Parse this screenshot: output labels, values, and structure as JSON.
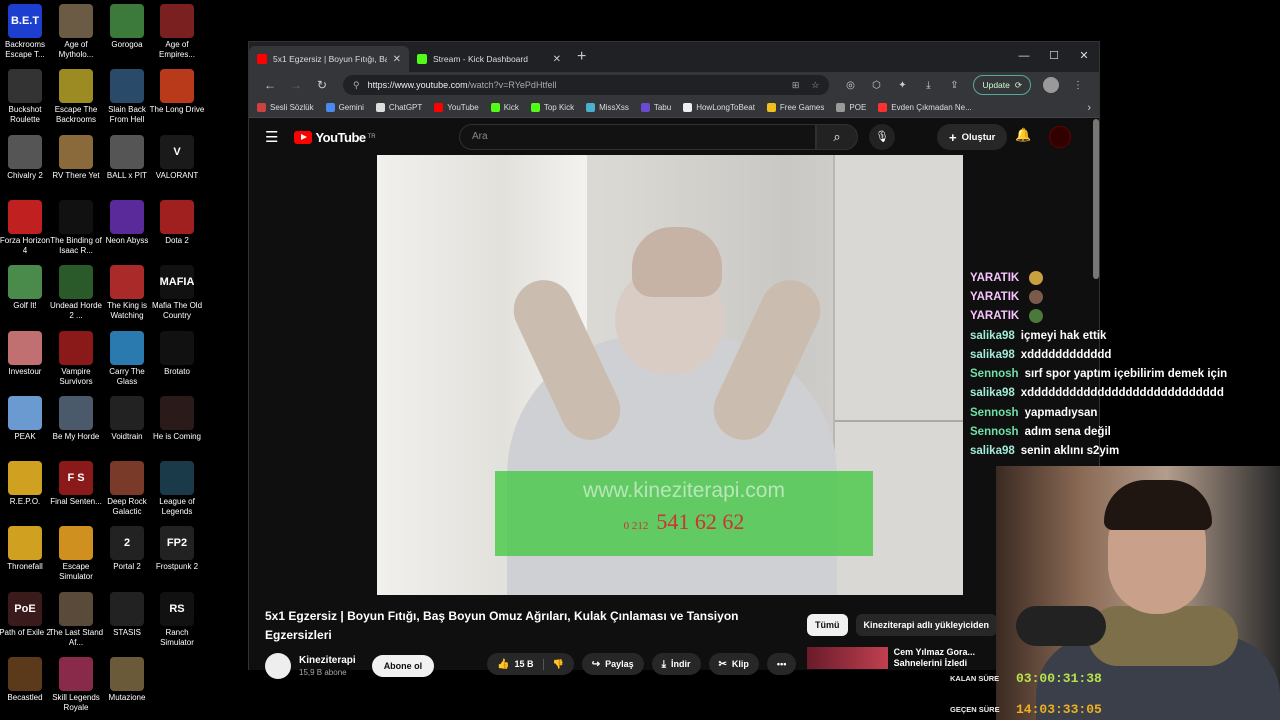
{
  "desktop_icons": [
    {
      "label": "Backrooms Escape T...",
      "bg": "#1d3fd0",
      "glyph": "B.E.T"
    },
    {
      "label": "Age of Mytholo...",
      "bg": "#6b5a44",
      "glyph": ""
    },
    {
      "label": "Gorogoa",
      "bg": "#3c7a3c",
      "glyph": ""
    },
    {
      "label": "Age of Empires...",
      "bg": "#7a2020",
      "glyph": ""
    },
    {
      "label": "Buckshot Roulette",
      "bg": "#333",
      "glyph": ""
    },
    {
      "label": "Escape The Backrooms",
      "bg": "#9b8b22",
      "glyph": ""
    },
    {
      "label": "Slain Back From Hell",
      "bg": "#2a4a6a",
      "glyph": ""
    },
    {
      "label": "The Long Drive",
      "bg": "#b83a1a",
      "glyph": ""
    },
    {
      "label": "Chivalry 2",
      "bg": "#555",
      "glyph": ""
    },
    {
      "label": "RV There Yet",
      "bg": "#8a6a3a",
      "glyph": ""
    },
    {
      "label": "BALL x PIT",
      "bg": "#555",
      "glyph": ""
    },
    {
      "label": "VALORANT",
      "bg": "#1a1a1a",
      "glyph": "V"
    },
    {
      "label": "Forza Horizon 4",
      "bg": "#c02020",
      "glyph": ""
    },
    {
      "label": "The Binding of Isaac R...",
      "bg": "#111",
      "glyph": ""
    },
    {
      "label": "Neon Abyss",
      "bg": "#5a2a9a",
      "glyph": ""
    },
    {
      "label": "Dota 2",
      "bg": "#a02020",
      "glyph": ""
    },
    {
      "label": "Golf It!",
      "bg": "#4a8a4a",
      "glyph": ""
    },
    {
      "label": "Undead Horde 2 ...",
      "bg": "#2a5a2a",
      "glyph": ""
    },
    {
      "label": "The King is Watching",
      "bg": "#aa2a2a",
      "glyph": ""
    },
    {
      "label": "Mafia The Old Country",
      "bg": "#111",
      "glyph": "MAFIA"
    },
    {
      "label": "Investour",
      "bg": "#c07070",
      "glyph": ""
    },
    {
      "label": "Vampire Survivors",
      "bg": "#8a1a1a",
      "glyph": ""
    },
    {
      "label": "Carry The Glass",
      "bg": "#2a7ab0",
      "glyph": ""
    },
    {
      "label": "Brotato",
      "bg": "#111",
      "glyph": ""
    },
    {
      "label": "PEAK",
      "bg": "#6a9ad0",
      "glyph": ""
    },
    {
      "label": "Be My Horde",
      "bg": "#4a5a6a",
      "glyph": ""
    },
    {
      "label": "Voidtrain",
      "bg": "#222",
      "glyph": ""
    },
    {
      "label": "He is Coming",
      "bg": "#2a1a1a",
      "glyph": ""
    },
    {
      "label": "R.E.P.O.",
      "bg": "#d0a020",
      "glyph": ""
    },
    {
      "label": "Final Senten...",
      "bg": "#8a1a1a",
      "glyph": "F S"
    },
    {
      "label": "Deep Rock Galactic",
      "bg": "#7a3a2a",
      "glyph": ""
    },
    {
      "label": "League of Legends",
      "bg": "#1a3a4a",
      "glyph": ""
    },
    {
      "label": "Thronefall",
      "bg": "#d0a020",
      "glyph": ""
    },
    {
      "label": "Escape Simulator",
      "bg": "#d09020",
      "glyph": ""
    },
    {
      "label": "Portal 2",
      "bg": "#222",
      "glyph": "2"
    },
    {
      "label": "Frostpunk 2",
      "bg": "#222",
      "glyph": "FP2"
    },
    {
      "label": "Path of Exile 2",
      "bg": "#3a1a1a",
      "glyph": "PoE"
    },
    {
      "label": "The Last Stand Af...",
      "bg": "#5a4a3a",
      "glyph": ""
    },
    {
      "label": "STASIS",
      "bg": "#222",
      "glyph": ""
    },
    {
      "label": "Ranch Simulator",
      "bg": "#111",
      "glyph": "RS"
    },
    {
      "label": "Becastled",
      "bg": "#5a3a1a",
      "glyph": ""
    },
    {
      "label": "Skill Legends Royale",
      "bg": "#8a2a4a",
      "glyph": ""
    },
    {
      "label": "Mutazione",
      "bg": "#6a5a3a",
      "glyph": ""
    }
  ],
  "browser": {
    "tabs": [
      {
        "title": "5x1 Egzersiz | Boyun Fıtığı, Baş Bo...",
        "favicon_color": "#ff0000",
        "active": true
      },
      {
        "title": "Stream - Kick Dashboard",
        "favicon_color": "#53fc18",
        "active": false
      }
    ],
    "new_tab": "+",
    "window_controls": [
      "—",
      "☐",
      "✕"
    ],
    "url_host": "https://www.youtube.com",
    "url_path": "/watch?v=RYePdHtfell",
    "update_label": "Update",
    "bookmarks": [
      {
        "label": "Sesli Sözlük",
        "color": "#d04040"
      },
      {
        "label": "Gemini",
        "color": "#4a8af0"
      },
      {
        "label": "ChatGPT",
        "color": "#ddd"
      },
      {
        "label": "YouTube",
        "color": "#ff0000"
      },
      {
        "label": "Kick",
        "color": "#53fc18"
      },
      {
        "label": "Top Kick",
        "color": "#53fc18"
      },
      {
        "label": "MissXss",
        "color": "#4ab0d0"
      },
      {
        "label": "Tabu",
        "color": "#6a4ad0"
      },
      {
        "label": "HowLongToBeat",
        "color": "#eee"
      },
      {
        "label": "Free Games",
        "color": "#f0c020"
      },
      {
        "label": "POE",
        "color": "#999"
      },
      {
        "label": "Evden Çıkmadan Ne...",
        "color": "#ff3030"
      }
    ]
  },
  "youtube": {
    "logo_text": "YouTube",
    "region": "TR",
    "search_placeholder": "Ara",
    "create_label": "Oluştur",
    "watermark_url": "www.kineziterapi.com",
    "watermark_prefix": "0 212",
    "watermark_phone": "541 62 62",
    "video_title": "5x1 Egzersiz | Boyun Fıtığı, Baş Boyun Omuz Ağrıları, Kulak Çınlaması ve Tansiyon Egzersizleri",
    "channel_name": "Kineziterapi",
    "channel_subs": "15,9 B abone",
    "subscribe_label": "Abone ol",
    "like_count": "15 B",
    "share_label": "Paylaş",
    "download_label": "İndir",
    "clip_label": "Klip",
    "more": "•••",
    "chips": [
      "Tümü",
      "Kineziterapi adlı yükleyiciden"
    ],
    "reco_title": "Cem Yılmaz Gora... Sahnelerini İzledi"
  },
  "chat": [
    {
      "user": "YARATIK",
      "msg": "",
      "user_color": "#f7c4ff",
      "emoji_color": "#c8a040"
    },
    {
      "user": "YARATIK",
      "msg": "",
      "user_color": "#f7c4ff",
      "emoji_color": "#7a5a4a"
    },
    {
      "user": "YARATIK",
      "msg": "",
      "user_color": "#f7c4ff",
      "emoji_color": "#4a7a3a"
    },
    {
      "user": "salika98",
      "msg": "içmeyi hak ettik",
      "user_color": "#a0ecd8",
      "emoji_color": ""
    },
    {
      "user": "salika98",
      "msg": "xdddddddddddd",
      "user_color": "#a0ecd8",
      "emoji_color": ""
    },
    {
      "user": "Sennosh",
      "msg": "sırf spor yaptım içebilirim demek için",
      "user_color": "#6fe0a8",
      "emoji_color": ""
    },
    {
      "user": "salika98",
      "msg": "xdddddddddddddddddddddddddddd",
      "user_color": "#a0ecd8",
      "emoji_color": ""
    },
    {
      "user": "Sennosh",
      "msg": "yapmadıysan",
      "user_color": "#6fe0a8",
      "emoji_color": ""
    },
    {
      "user": "Sennosh",
      "msg": "adım sena değil",
      "user_color": "#6fe0a8",
      "emoji_color": ""
    },
    {
      "user": "salika98",
      "msg": "senin aklını s2yim",
      "user_color": "#a0ecd8",
      "emoji_color": ""
    }
  ],
  "timers": {
    "remaining_label": "KALAN SÜRE",
    "remaining_value": "03:00:31:38",
    "remaining_color": "#b9e34a",
    "elapsed_label": "GEÇEN SÜRE",
    "elapsed_value": "14:03:33:05",
    "elapsed_color": "#f0b020"
  }
}
